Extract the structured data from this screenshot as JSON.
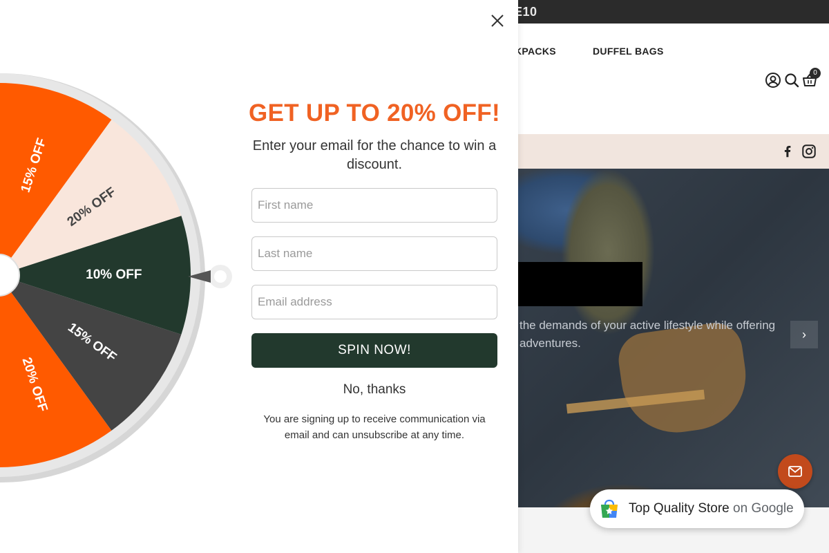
{
  "store": {
    "announcement": "E10",
    "nav": {
      "backpacks": "KPACKS",
      "duffel_bags": "DUFFEL BAGS"
    },
    "cart_count": "0",
    "hero": {
      "description": "the demands of your active lifestyle while offering adventures.",
      "next_label": "›"
    },
    "google_badge": {
      "store_name": "Top Quality Store",
      "suffix": "on Google"
    }
  },
  "popup": {
    "title": "GET UP TO 20% OFF!",
    "subtitle": "Enter your email for the chance to win a discount.",
    "fields": {
      "first_name_placeholder": "First name",
      "last_name_placeholder": "Last name",
      "email_placeholder": "Email address"
    },
    "spin_button": "SPIN NOW!",
    "decline": "No, thanks",
    "fine_print": "You are signing up to receive communication via email and can unsubscribe at any time.",
    "wheel": {
      "slices": [
        {
          "label": "10% OFF",
          "color": "#22392d",
          "text_color": "#ffffff"
        },
        {
          "label": "15% OFF",
          "color": "#444444",
          "text_color": "#ffffff"
        },
        {
          "label": "20% OFF",
          "color": "#ff5a00",
          "text_color": "#ffffff"
        },
        {
          "label": "10% OFF",
          "color": "#f9e6dc",
          "text_color": "#444444"
        },
        {
          "label": "15% OFF",
          "color": "#444444",
          "text_color": "#ffffff"
        },
        {
          "label": "20% OFF",
          "color": "#ff5a00",
          "text_color": "#ffffff"
        },
        {
          "label": "10% OFF",
          "color": "#f9e6dc",
          "text_color": "#444444"
        },
        {
          "label": "15% OFF",
          "color": "#444444",
          "text_color": "#ffffff"
        },
        {
          "label": "15% OFF",
          "color": "#ff5a00",
          "text_color": "#ffffff"
        },
        {
          "label": "20% OFF",
          "color": "#f9e6dc",
          "text_color": "#444444"
        }
      ]
    }
  },
  "colors": {
    "accent": "#f06223",
    "button": "#22392d",
    "announcement_bg": "#2b2b2b",
    "social_bar_bg": "#f1e5de"
  }
}
